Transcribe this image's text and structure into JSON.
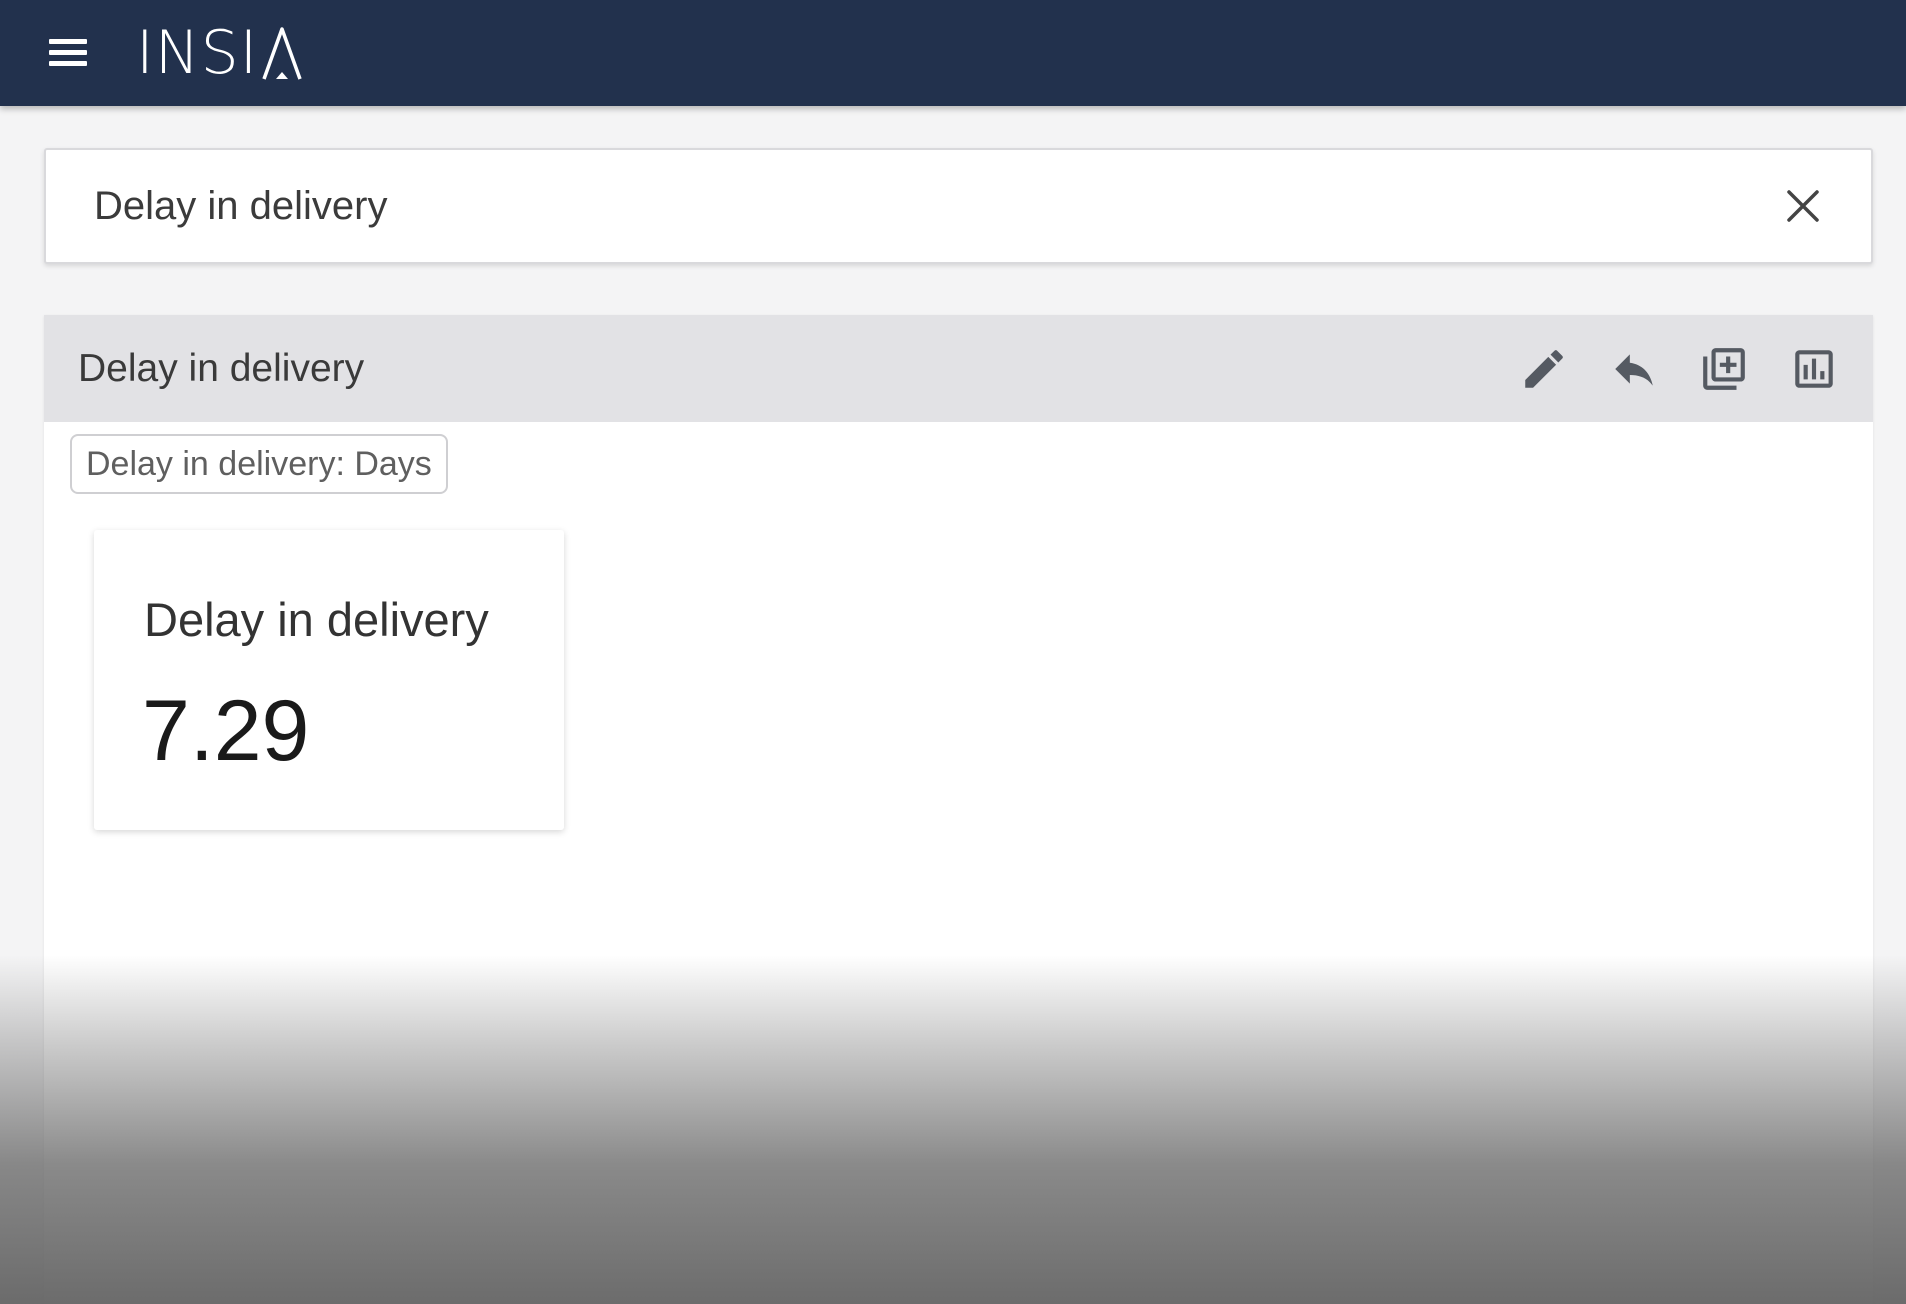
{
  "header": {
    "logo_text": "INSI",
    "logo_accent_icon": "triangle-a-logo-icon",
    "menu_icon": "hamburger-menu-icon",
    "background_color": "#22314d"
  },
  "search": {
    "value": "Delay in delivery",
    "clear_icon": "close-icon"
  },
  "result": {
    "title": "Delay in delivery",
    "actions": [
      {
        "name": "edit",
        "icon": "pencil-icon"
      },
      {
        "name": "reply",
        "icon": "reply-arrow-icon"
      },
      {
        "name": "add-to-dashboard",
        "icon": "library-add-icon"
      },
      {
        "name": "chart-view",
        "icon": "bar-chart-icon"
      }
    ],
    "filter_chip": "Delay in delivery: Days",
    "kpi": {
      "label": "Delay in delivery",
      "value": "7.29"
    }
  }
}
